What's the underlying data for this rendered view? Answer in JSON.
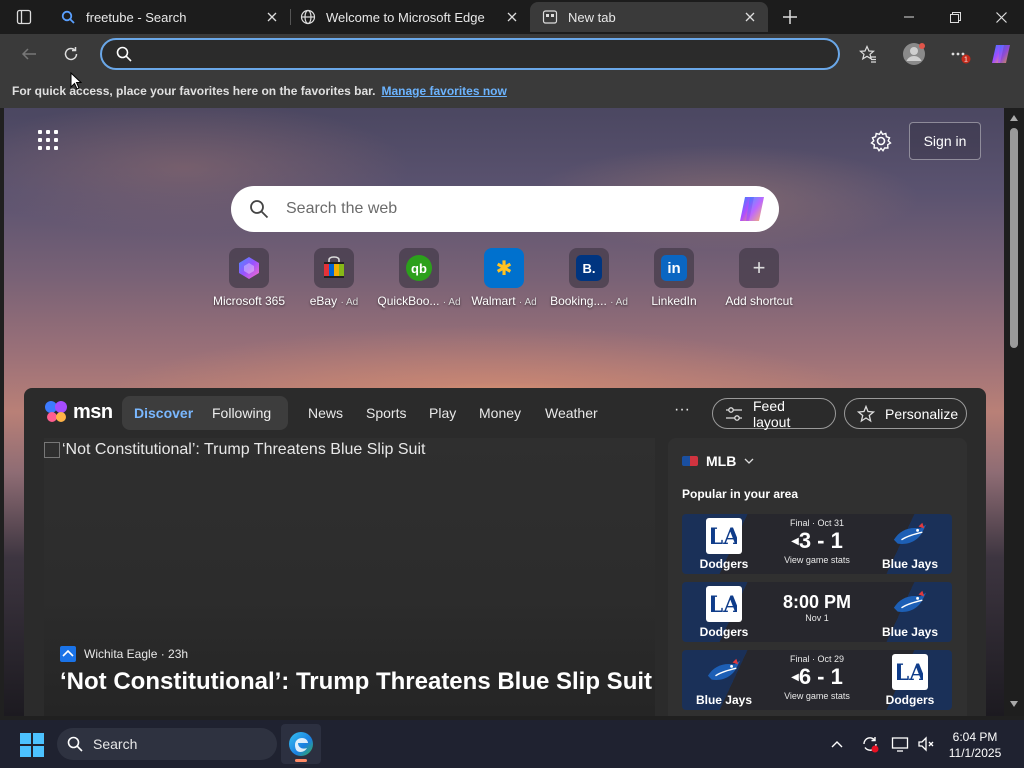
{
  "browser": {
    "tabs": [
      {
        "title": "freetube - Search",
        "icon": "search-icon",
        "active": false
      },
      {
        "title": "Welcome to Microsoft Edge",
        "icon": "globe-icon",
        "active": false
      },
      {
        "title": "New tab",
        "icon": "new-tab-icon",
        "active": true
      }
    ],
    "address": {
      "value": "",
      "placeholder": ""
    }
  },
  "favorites_bar": {
    "text": "For quick access, place your favorites here on the favorites bar.",
    "link": "Manage favorites now"
  },
  "newtab": {
    "signin_label": "Sign in",
    "search_placeholder": "Search the web",
    "shortcuts": [
      {
        "label": "Microsoft 365",
        "ad": "",
        "color": "#7a5bd6",
        "icon": "microsoft-365-icon"
      },
      {
        "label": "eBay",
        "ad": "· Ad",
        "color": "#e53238",
        "icon": "ebay-icon"
      },
      {
        "label": "QuickBoo...",
        "ad": "· Ad",
        "color": "#2ca01c",
        "icon": "quickbooks-icon",
        "glyph": "qb"
      },
      {
        "label": "Walmart",
        "ad": "· Ad",
        "color": "#0071ce",
        "icon": "walmart-icon",
        "glyph": "✱"
      },
      {
        "label": "Booking....",
        "ad": "· Ad",
        "color": "#003580",
        "icon": "booking-icon",
        "glyph": "B."
      },
      {
        "label": "LinkedIn",
        "ad": "",
        "color": "#0a66c2",
        "icon": "linkedin-icon",
        "glyph": "in"
      },
      {
        "label": "Add shortcut",
        "ad": "",
        "color": "",
        "icon": "plus-icon",
        "glyph": "+"
      }
    ]
  },
  "feed": {
    "logo": "msn",
    "toggle": [
      "Discover",
      "Following"
    ],
    "nav": [
      "News",
      "Sports",
      "Play",
      "Money",
      "Weather"
    ],
    "more": "···",
    "feed_layout": "Feed layout",
    "personalize": "Personalize",
    "hero": {
      "alt": "‘Not Constitutional’: Trump Threatens Blue Slip Suit",
      "source": "Wichita Eagle",
      "age": "· 23h",
      "title": "‘Not Constitutional’: Trump Threatens Blue Slip Suit"
    },
    "mlb": {
      "title": "MLB",
      "subtitle": "Popular in your area",
      "games": [
        {
          "left_team": "Dodgers",
          "right_team": "Blue Jays",
          "status": "Final · Oct 31",
          "score": "3 - 1",
          "foot": "View game stats"
        },
        {
          "left_team": "Dodgers",
          "right_team": "Blue Jays",
          "status": "",
          "score": "8:00 PM",
          "foot": "Nov 1"
        },
        {
          "left_team": "Blue Jays",
          "right_team": "Dodgers",
          "status": "Final · Oct 29",
          "score": "6 - 1",
          "foot": "View game stats"
        }
      ]
    }
  },
  "taskbar": {
    "search_label": "Search",
    "time": "6:04 PM",
    "date": "11/1/2025"
  },
  "colors": {
    "accent": "#6aa7e8",
    "link": "#6cb4ff",
    "discover": "#7ab8ff"
  }
}
